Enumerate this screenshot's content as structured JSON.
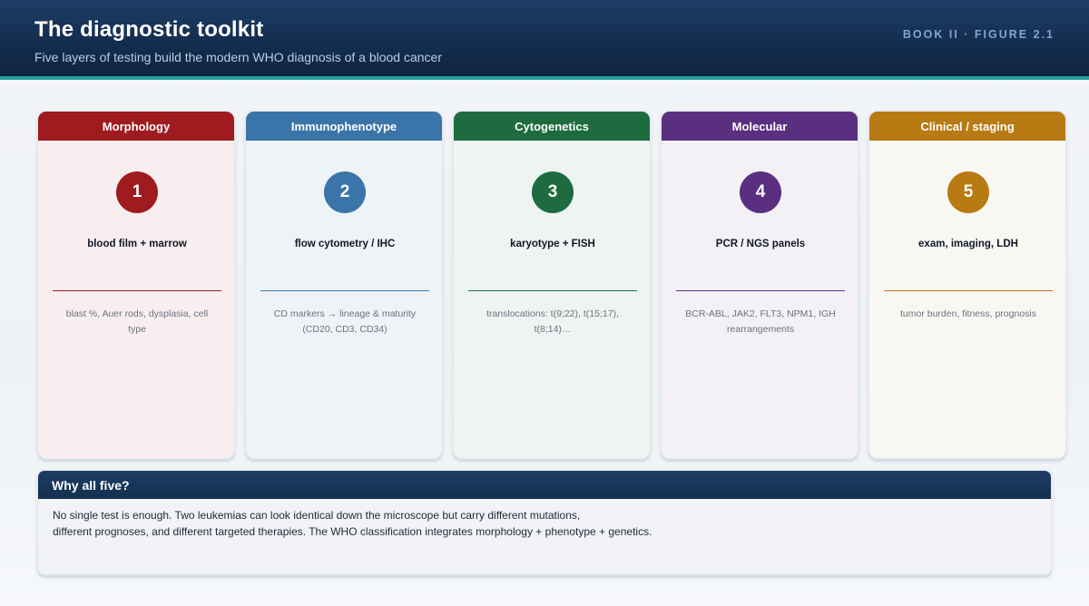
{
  "header": {
    "title": "The diagnostic toolkit",
    "subtitle": "Five layers of testing build the modern WHO diagnosis of a blood cancer",
    "figure_tag": "BOOK II · FIGURE 2.1"
  },
  "cards": [
    {
      "label": "Morphology",
      "number": "1",
      "test": "blood film + marrow",
      "description": "blast %, Auer rods, dysplasia, cell type",
      "color": "#9e1b1f",
      "tint": "#f8eeef"
    },
    {
      "label": "Immunophenotype",
      "number": "2",
      "test": "flow cytometry / IHC",
      "description": "CD markers → lineage & maturity (CD20, CD3, CD34)",
      "color": "#3b74a8",
      "tint": "#eef3f8"
    },
    {
      "label": "Cytogenetics",
      "number": "3",
      "test": "karyotype + FISH",
      "description": "translocations: t(9;22), t(15;17), t(8;14)…",
      "color": "#1e6b3f",
      "tint": "#eef4f1"
    },
    {
      "label": "Molecular",
      "number": "4",
      "test": "PCR / NGS panels",
      "description": "BCR-ABL, JAK2, FLT3, NPM1, IGH rearrangements",
      "color": "#5a2f7f",
      "tint": "#f3f1f6"
    },
    {
      "label": "Clinical / staging",
      "number": "5",
      "test": "exam, imaging, LDH",
      "description": "tumor burden, fitness, prognosis",
      "color": "#b87a12",
      "tint": "#f8f7f2"
    }
  ],
  "why": {
    "heading": "Why all five?",
    "line1": "No single test is enough. Two leukemias can look identical down the microscope but carry different mutations,",
    "line2": "different prognoses, and different targeted therapies. The WHO classification integrates morphology + phenotype + genetics."
  }
}
